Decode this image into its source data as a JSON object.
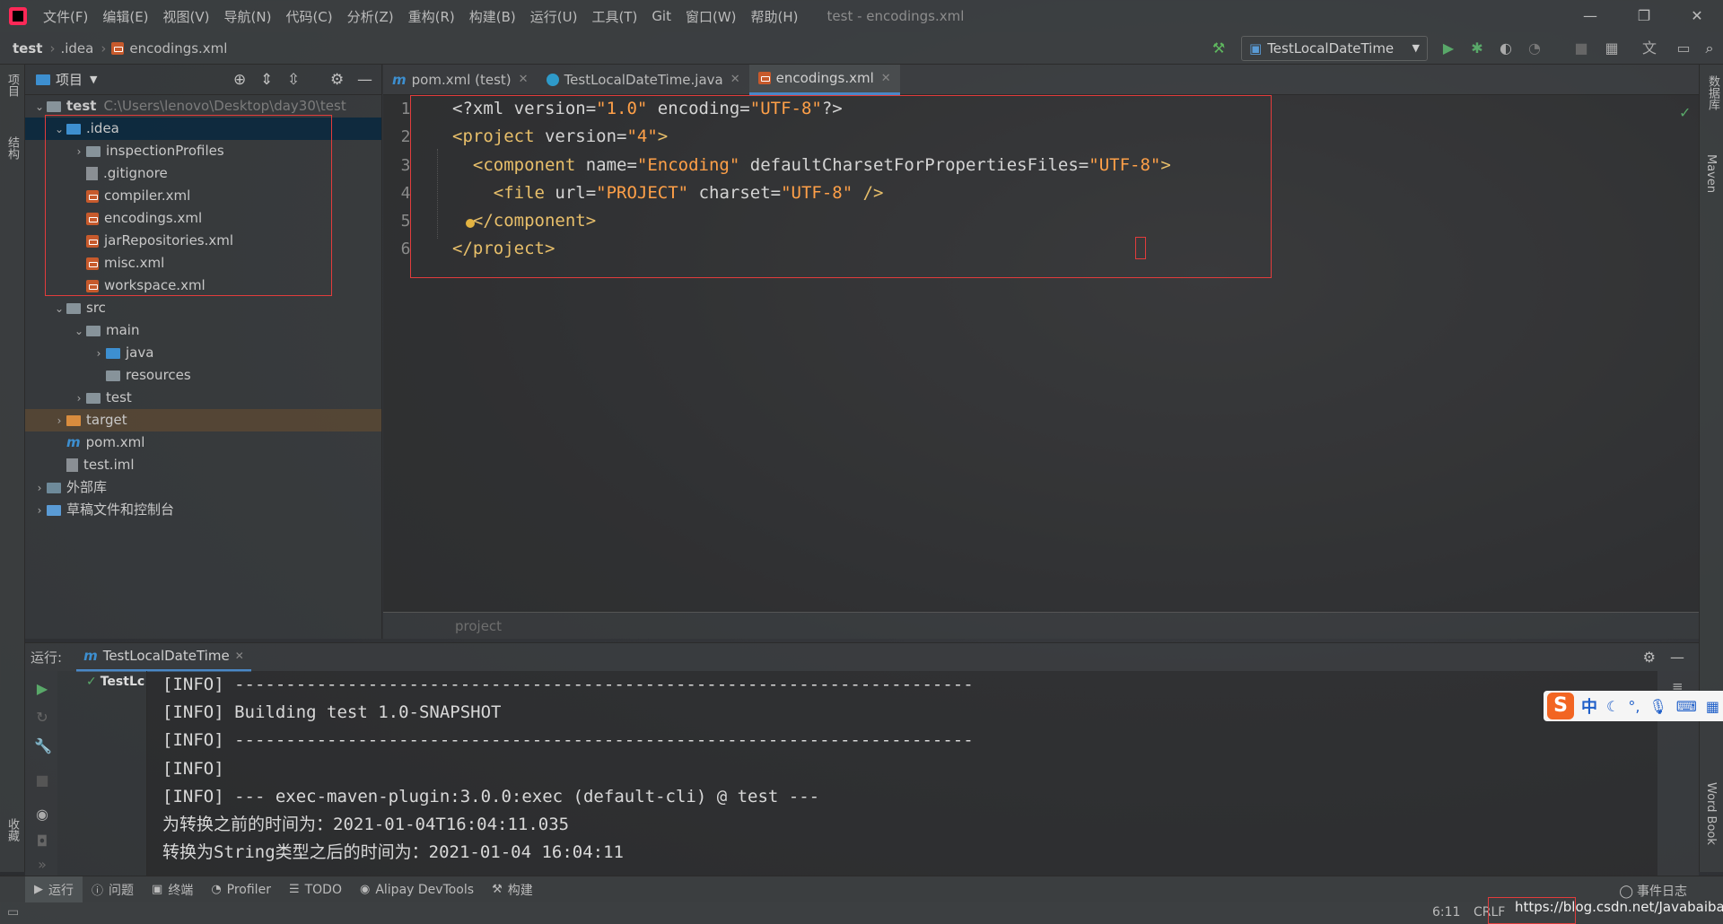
{
  "menubar": {
    "items": [
      "文件(F)",
      "编辑(E)",
      "视图(V)",
      "导航(N)",
      "代码(C)",
      "分析(Z)",
      "重构(R)",
      "构建(B)",
      "运行(U)",
      "工具(T)",
      "Git",
      "窗口(W)",
      "帮助(H)"
    ],
    "window_title": "test - encodings.xml",
    "window_buttons": [
      "—",
      "❐",
      "✕"
    ]
  },
  "navbar": {
    "crumbs": [
      "test",
      ".idea",
      "encodings.xml"
    ],
    "run_config": "TestLocalDateTime"
  },
  "left_strip": {
    "labels": [
      "项目",
      "结构",
      "收藏"
    ]
  },
  "right_strip": {
    "labels": [
      "数据库",
      "Maven",
      "Word Book"
    ]
  },
  "project_panel": {
    "title": "项目",
    "tree": [
      {
        "label": "test",
        "path": "C:\\Users\\lenovo\\Desktop\\day30\\test",
        "indent": 0,
        "arrow": "⌄",
        "icon": "folder"
      },
      {
        "label": ".idea",
        "indent": 1,
        "arrow": "⌄",
        "icon": "folder-blue",
        "selected": true
      },
      {
        "label": "inspectionProfiles",
        "indent": 2,
        "arrow": "›",
        "icon": "folder"
      },
      {
        "label": ".gitignore",
        "indent": 2,
        "arrow": "",
        "icon": "file"
      },
      {
        "label": "compiler.xml",
        "indent": 2,
        "arrow": "",
        "icon": "xml"
      },
      {
        "label": "encodings.xml",
        "indent": 2,
        "arrow": "",
        "icon": "xml"
      },
      {
        "label": "jarRepositories.xml",
        "indent": 2,
        "arrow": "",
        "icon": "xml"
      },
      {
        "label": "misc.xml",
        "indent": 2,
        "arrow": "",
        "icon": "xml"
      },
      {
        "label": "workspace.xml",
        "indent": 2,
        "arrow": "",
        "icon": "xml"
      },
      {
        "label": "src",
        "indent": 1,
        "arrow": "⌄",
        "icon": "folder"
      },
      {
        "label": "main",
        "indent": 2,
        "arrow": "⌄",
        "icon": "folder"
      },
      {
        "label": "java",
        "indent": 3,
        "arrow": "›",
        "icon": "folder-blue"
      },
      {
        "label": "resources",
        "indent": 3,
        "arrow": "",
        "icon": "folder"
      },
      {
        "label": "test",
        "indent": 2,
        "arrow": "›",
        "icon": "folder"
      },
      {
        "label": "target",
        "indent": 1,
        "arrow": "›",
        "icon": "folder-orange",
        "target": true
      },
      {
        "label": "pom.xml",
        "indent": 1,
        "arrow": "",
        "icon": "maven"
      },
      {
        "label": "test.iml",
        "indent": 1,
        "arrow": "",
        "icon": "file"
      },
      {
        "label": "外部库",
        "indent": 0,
        "arrow": "›",
        "icon": "lib"
      },
      {
        "label": "草稿文件和控制台",
        "indent": 0,
        "arrow": "›",
        "icon": "scratch"
      }
    ]
  },
  "editor": {
    "tabs": [
      {
        "label": "pom.xml (test)",
        "icon": "maven",
        "active": false
      },
      {
        "label": "TestLocalDateTime.java",
        "icon": "java",
        "active": false
      },
      {
        "label": "encodings.xml",
        "icon": "xml",
        "active": true
      }
    ],
    "line_numbers": [
      "1",
      "2",
      "3",
      "4",
      "5",
      "6"
    ],
    "breadcrumb": "project"
  },
  "run_panel": {
    "label": "运行:",
    "tab": "TestLocalDateTime",
    "tree_item": "TestLc",
    "console": [
      "[INFO] ------------------------------------------------------------------------",
      "[INFO] Building test 1.0-SNAPSHOT",
      "[INFO] ------------------------------------------------------------------------",
      "[INFO]",
      "[INFO] --- exec-maven-plugin:3.0.0:exec (default-cli) @ test ---",
      "为转换之前的时间为：2021-01-04T16:04:11.035",
      "转换为String类型之后的时间为：2021-01-04 16:04:11"
    ]
  },
  "bottom_tabs": [
    {
      "label": "运行",
      "icon": "▶",
      "active": true
    },
    {
      "label": "问题",
      "icon": "ⓘ"
    },
    {
      "label": "终端",
      "icon": "▣"
    },
    {
      "label": "Profiler",
      "icon": "◔"
    },
    {
      "label": "TODO",
      "icon": "☰"
    },
    {
      "label": "Alipay DevTools",
      "icon": "◉"
    },
    {
      "label": "构建",
      "icon": "⚒"
    }
  ],
  "event_log": "事件日志",
  "status": {
    "position": "6:11",
    "line_sep": "CRLF",
    "watermark": "https://blog.csdn.net/Javabaibai"
  },
  "ime": {
    "lang": "中"
  },
  "colors": {
    "accent": "#4a88c7",
    "highlight_box": "#e23c3c",
    "tag": "#e8bf6a",
    "value": "#ffa048"
  }
}
